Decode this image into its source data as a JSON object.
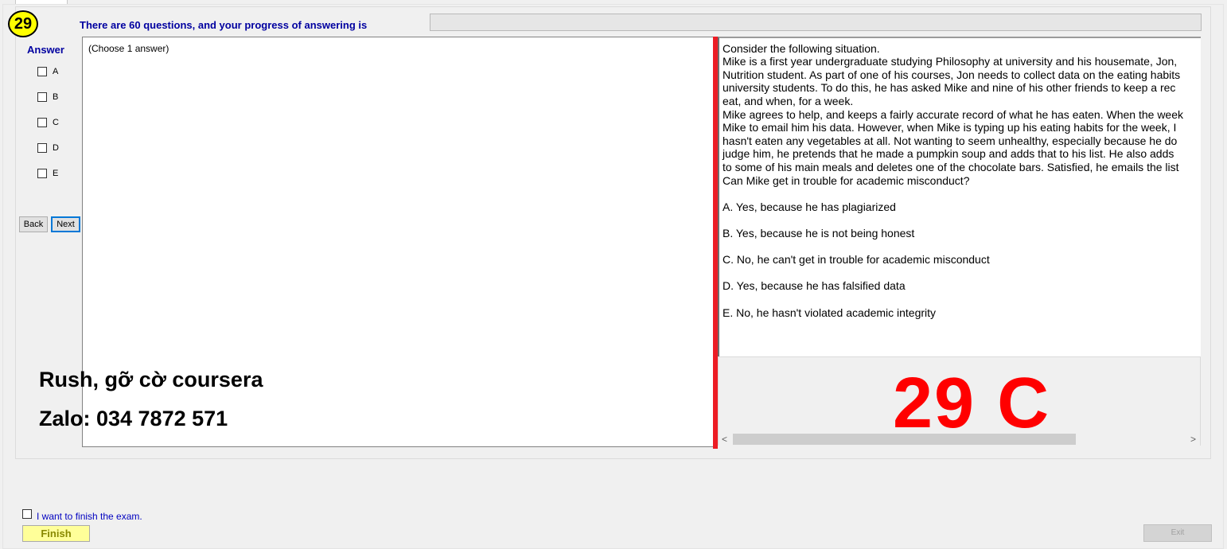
{
  "question_number": "29",
  "progress": {
    "label": "There are 60 questions, and your progress of answering is",
    "percent": 0
  },
  "answer_panel": {
    "title": "Answer",
    "options": [
      "A",
      "B",
      "C",
      "D",
      "E"
    ],
    "back_label": "Back",
    "next_label": "Next"
  },
  "answer_area": {
    "instruction": "(Choose 1 answer)"
  },
  "watermark": {
    "line1": "Rush, gỡ cờ coursera",
    "line2": "Zalo: 034 7872 571"
  },
  "question": {
    "lines": [
      "Consider the following situation.",
      "Mike is a first year undergraduate studying Philosophy at university and his housemate, Jon,",
      "Nutrition student. As part of one of his courses, Jon needs to collect data on the eating habits",
      "university students. To do this, he has asked Mike and nine of his other friends to keep a rec",
      "eat, and when, for a week.",
      "Mike agrees to help, and keeps a fairly accurate record of what he has eaten. When the week",
      "Mike to email him his data. However, when Mike is typing up his eating habits for the week, I",
      "hasn't eaten any vegetables at all. Not wanting to seem unhealthy, especially because he do",
      "judge him, he pretends that he made a pumpkin soup and adds that to his list. He also adds",
      "to some of his main meals and deletes one of the chocolate bars. Satisfied, he emails the list",
      "Can Mike get in trouble for academic misconduct?"
    ],
    "choices": [
      "A.  Yes, because he has plagiarized",
      "B.  Yes, because he is not being honest",
      "C.  No, he can't get in trouble for academic misconduct",
      "D.  Yes, because he has falsified data",
      "E.  No, he hasn't violated academic integrity"
    ]
  },
  "stamp": "29  C",
  "scroll": {
    "left_arrow": "<",
    "right_arrow": ">"
  },
  "footer": {
    "finish_check_label": "I want to finish the exam.",
    "finish_label": "Finish",
    "exit_label": "Exit"
  }
}
